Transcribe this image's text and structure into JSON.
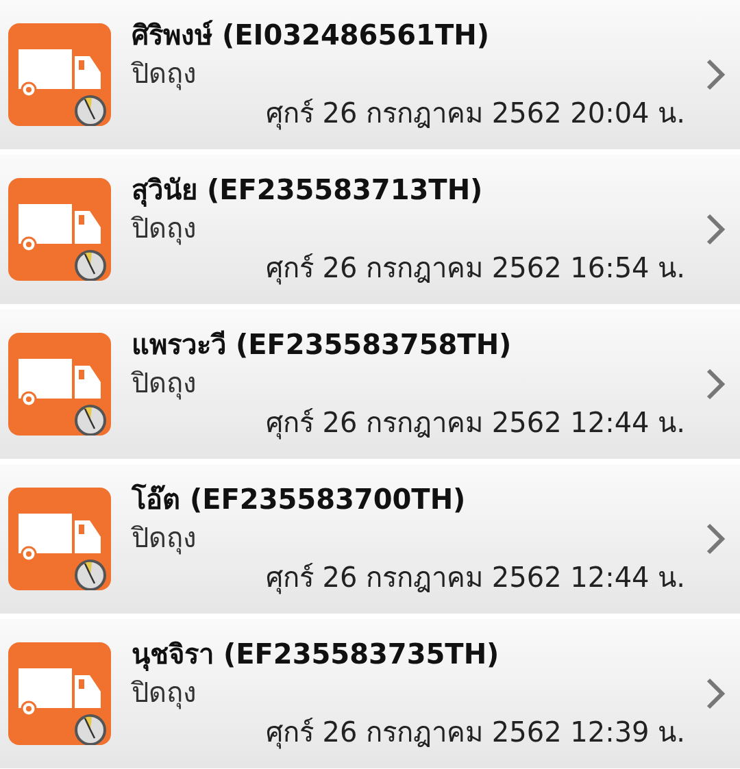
{
  "items": [
    {
      "title": "ศิริพงษ์ (EI032486561TH)",
      "status": "ปิดถุง",
      "datetime": "ศุกร์ 26 กรกฎาคม 2562 20:04 น."
    },
    {
      "title": "สุวินัย (EF235583713TH)",
      "status": "ปิดถุง",
      "datetime": "ศุกร์ 26 กรกฎาคม 2562 16:54 น."
    },
    {
      "title": "แพรวะวี (EF235583758TH)",
      "status": "ปิดถุง",
      "datetime": "ศุกร์ 26 กรกฎาคม 2562 12:44 น."
    },
    {
      "title": "โอ๊ต (EF235583700TH)",
      "status": "ปิดถุง",
      "datetime": "ศุกร์ 26 กรกฎาคม 2562 12:44 น."
    },
    {
      "title": "นุชจิรา (EF235583735TH)",
      "status": "ปิดถุง",
      "datetime": "ศุกร์ 26 กรกฎาคม 2562 12:39 น."
    }
  ]
}
